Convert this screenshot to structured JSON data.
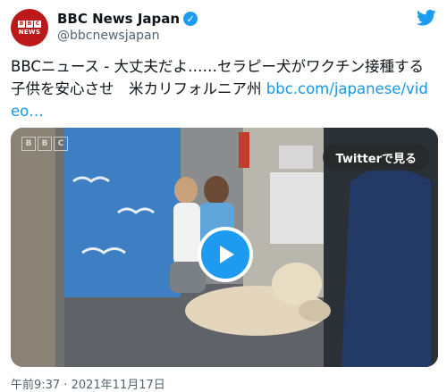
{
  "account": {
    "display_name": "BBC News Japan",
    "handle": "@bbcnewsjapan",
    "avatar_text": "NEWS",
    "avatar_logo": [
      "B",
      "B",
      "C"
    ],
    "verified_icon": "verified-badge-icon"
  },
  "tweet": {
    "text": "BBCニュース - 大丈夫だよ……セラピー犬がワクチン接種する子供を安心させ　米カリフォルニア州 ",
    "link_text": "bbc.com/japanese/video…",
    "timestamp": "午前9:37 · 2021年11月17日"
  },
  "media": {
    "watch_label": "Twitterで見る",
    "video_logo": [
      "B",
      "B",
      "C"
    ],
    "play_icon": "play-icon"
  },
  "colors": {
    "brand_red": "#bb1919",
    "twitter_blue": "#1d9bf0",
    "link_blue": "#1b95e0"
  }
}
